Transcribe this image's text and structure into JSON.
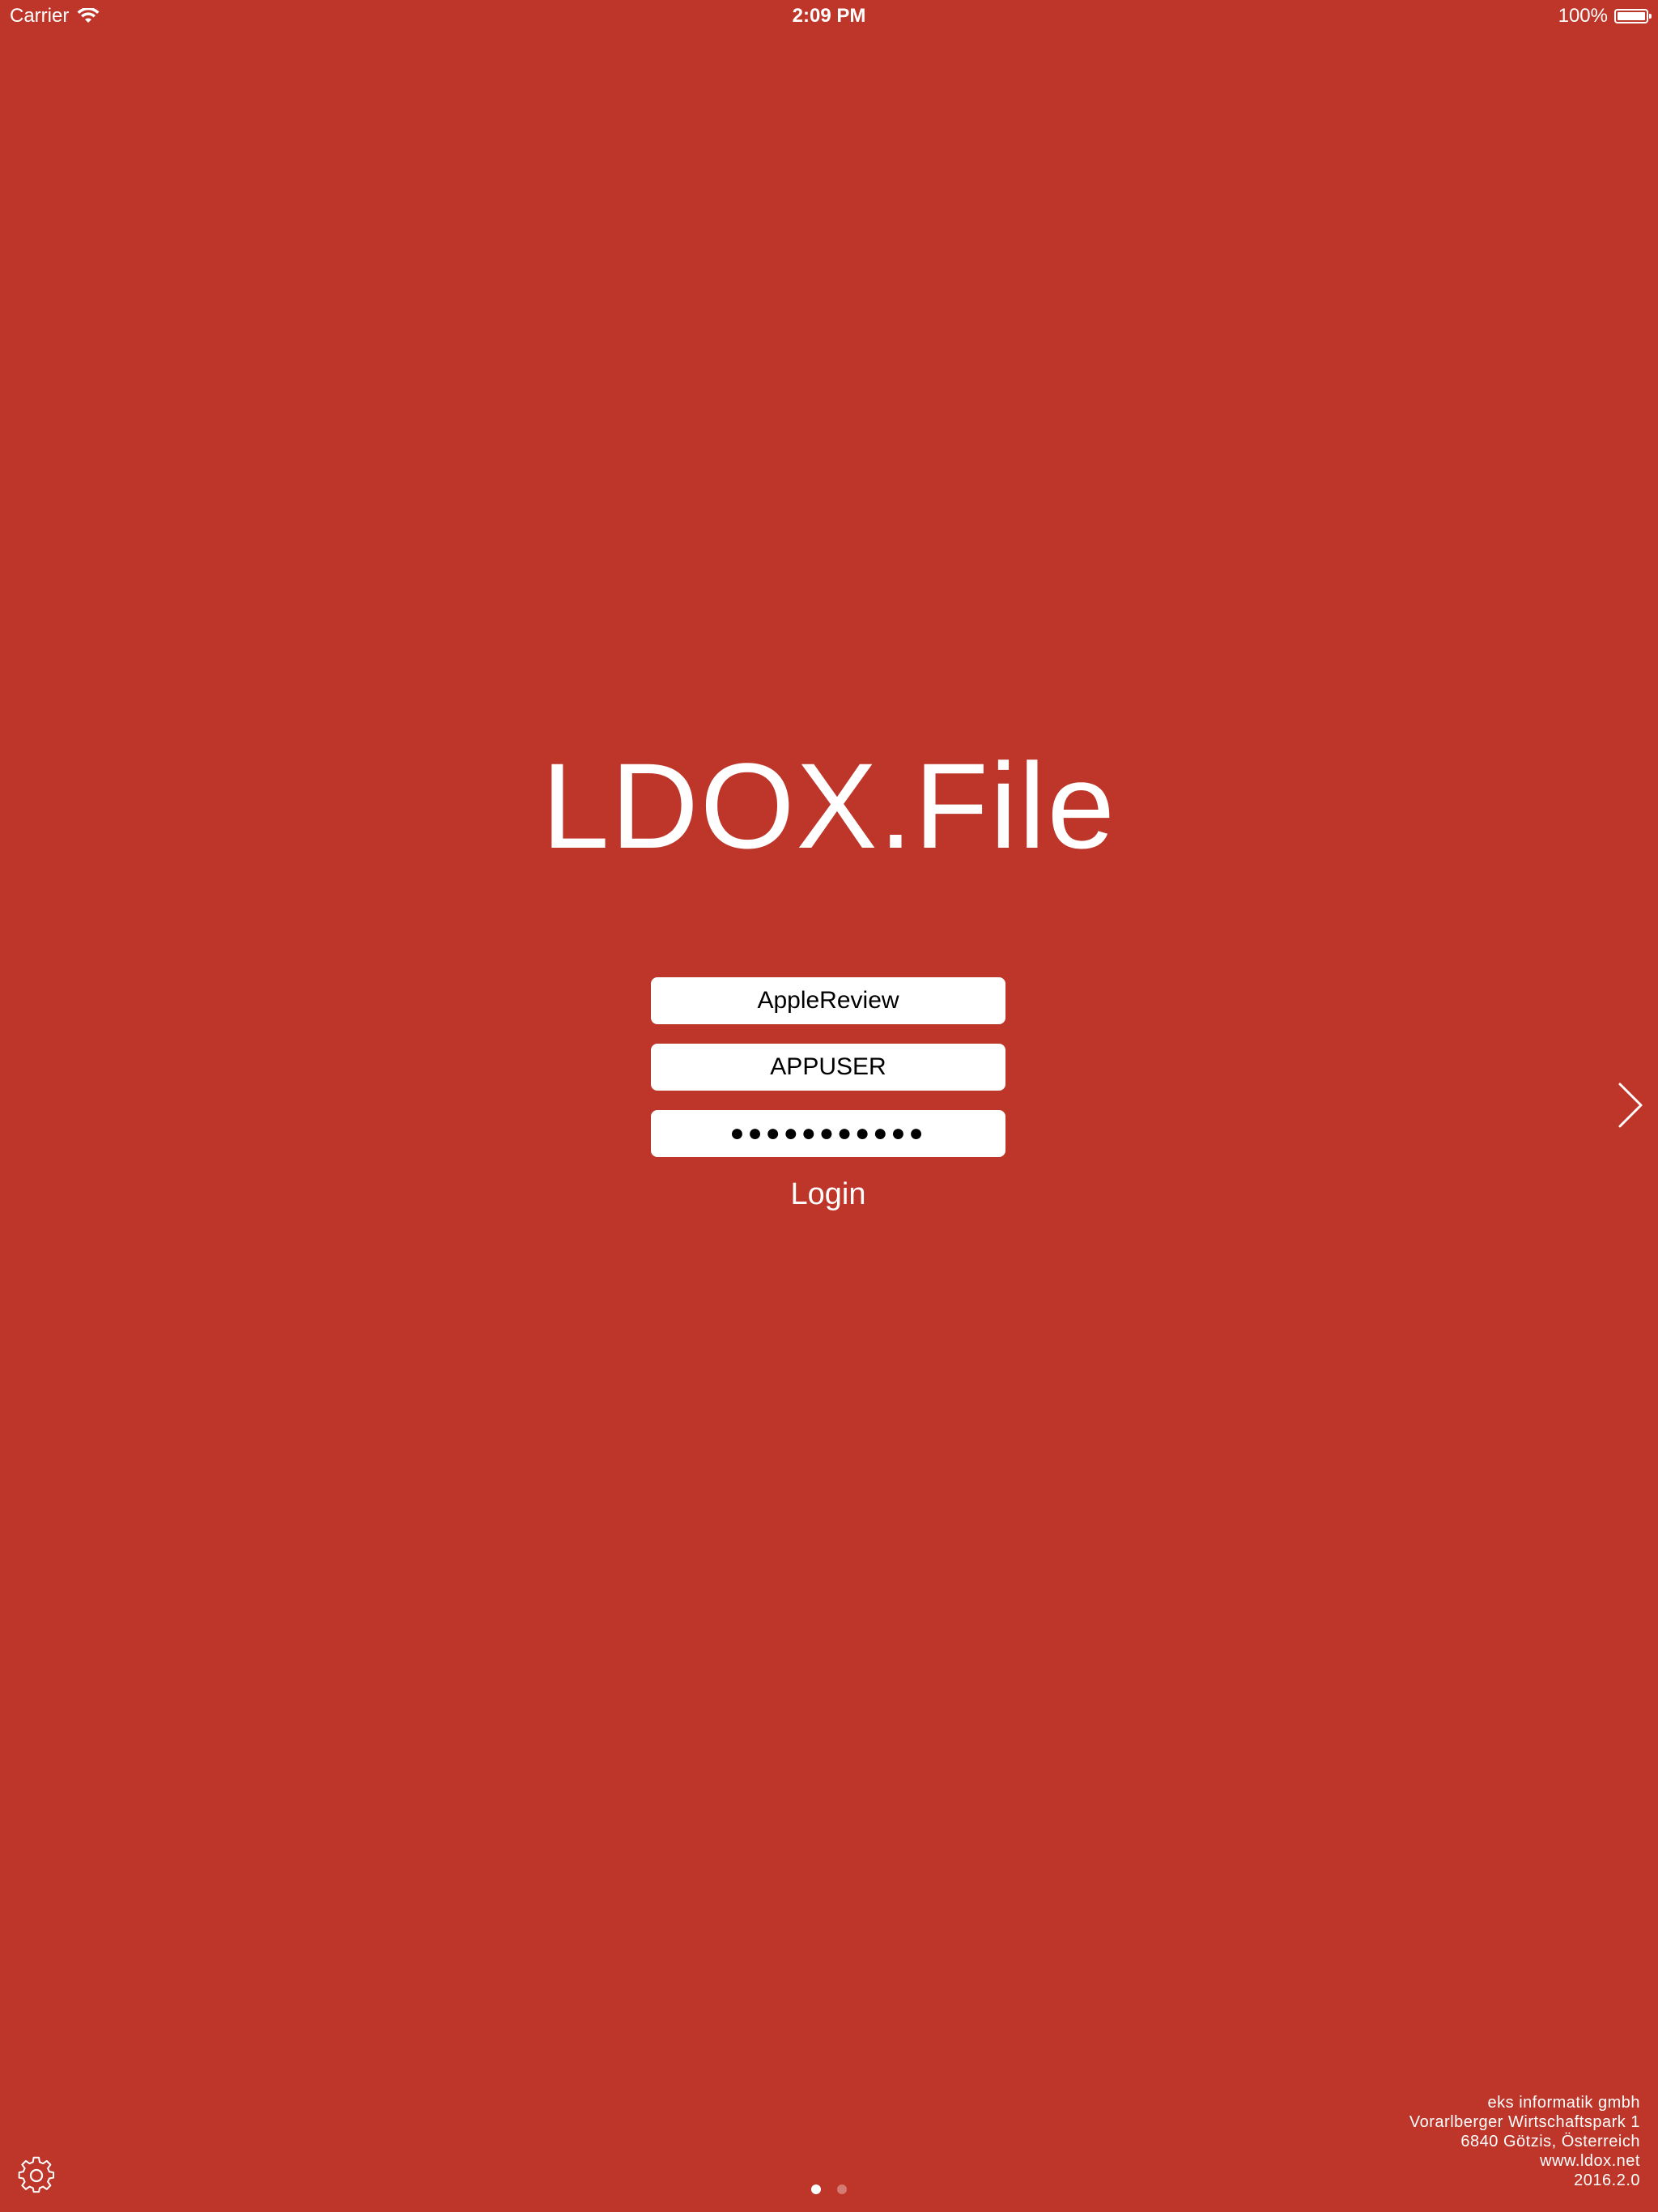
{
  "status_bar": {
    "carrier": "Carrier",
    "time": "2:09 PM",
    "battery": "100%"
  },
  "app": {
    "title": "LDOX.File"
  },
  "login": {
    "server": "AppleReview",
    "username": "APPUSER",
    "password_mask": "●●●●●●●●●●●",
    "button_label": "Login"
  },
  "company": {
    "name": "eks informatik gmbh",
    "street": "Vorarlberger Wirtschaftspark 1",
    "city": "6840 Götzis, Österreich",
    "website": "www.ldox.net",
    "version": "2016.2.0"
  },
  "pager": {
    "current_page": 1,
    "page_count": 2
  },
  "colors": {
    "background": "#bd3629",
    "text": "#ffffff"
  },
  "icons": {
    "wifi": "wifi-icon",
    "battery": "battery-icon",
    "next": "chevron-right-icon",
    "settings": "gear-icon"
  }
}
